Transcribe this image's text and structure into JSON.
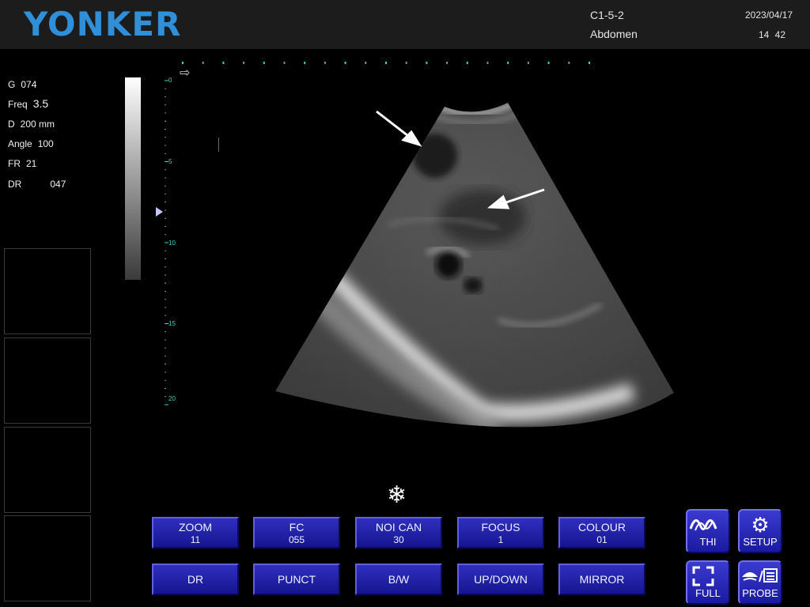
{
  "header": {
    "logo": "YONKER",
    "probe": "C1-5-2",
    "exam": "Abdomen",
    "date": "2023/04/17",
    "time": "14 42"
  },
  "params": [
    {
      "label": "G",
      "value": "074"
    },
    {
      "label": "Freq",
      "value": "3.5"
    },
    {
      "label": "D",
      "value": "200 mm"
    },
    {
      "label": "Angle",
      "value": "100"
    },
    {
      "label": "FR",
      "value": "21"
    },
    {
      "label": "DR",
      "value": "047"
    }
  ],
  "depth_scale": {
    "labels": [
      "0",
      "5",
      "10",
      "15",
      "20"
    ],
    "color": "#3ad1c1"
  },
  "colors": {
    "brand": "#2f8fd8",
    "button_face": "#2222aa",
    "scale_accent": "#3ad1c1"
  },
  "controls": {
    "row1": [
      {
        "label": "ZOOM",
        "value": "11"
      },
      {
        "label": "FC",
        "value": "055"
      },
      {
        "label": "NOI CAN",
        "value": "30"
      },
      {
        "label": "FOCUS",
        "value": "1"
      },
      {
        "label": "COLOUR",
        "value": "01"
      }
    ],
    "row2": [
      "DR",
      "PUNCT",
      "B/W",
      "UP/DOWN",
      "MIRROR"
    ],
    "side": [
      {
        "label": "THI",
        "icon": "thi-wave-icon"
      },
      {
        "label": "SETUP",
        "icon": "gear-icon"
      },
      {
        "label": "FULL",
        "icon": "fullscreen-icon"
      },
      {
        "label": "PROBE",
        "icon": "probe-icon"
      }
    ]
  },
  "status": {
    "frozen": true,
    "freeze_icon": "snowflake-icon",
    "freeze_glyph": "❄"
  }
}
